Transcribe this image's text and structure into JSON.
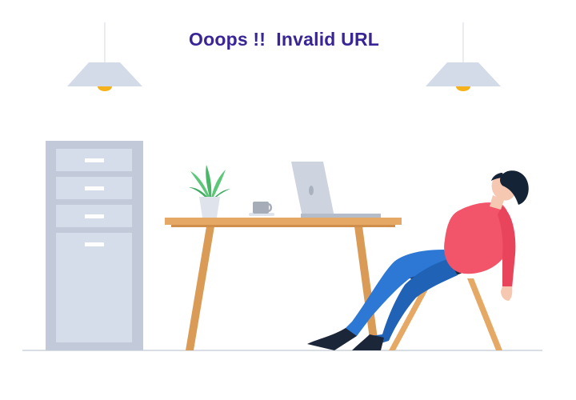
{
  "message": {
    "title": "Ooops !!  Invalid URL"
  },
  "illustration": {
    "subject": "tired-person-reclining-in-chair-at-desk",
    "icons": [
      "ceiling-lamp-icon",
      "filing-cabinet-icon",
      "desk-icon",
      "plant-icon",
      "coffee-cup-icon",
      "laptop-icon",
      "person-icon",
      "chair-icon"
    ],
    "colors": {
      "title": "#3a2596",
      "lamp_shade": "#d4dbe8",
      "lamp_bulb": "#f5b21c",
      "cabinet": "#c2cad9",
      "cabinet_drawer": "#d6ddea",
      "desk": "#e6a965",
      "desk_legs": "#d99b55",
      "shirt": "#f2546a",
      "pants": "#2c78d4",
      "hair": "#152336",
      "skin": "#f6c8b1",
      "plant": "#5cc779",
      "laptop": "#cdd3df",
      "floor": "#d9dde4"
    }
  }
}
